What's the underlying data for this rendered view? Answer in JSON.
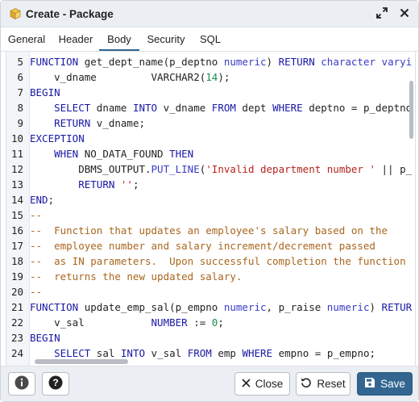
{
  "dialog": {
    "title": "Create - Package"
  },
  "tabs": [
    {
      "label": "General",
      "active": false
    },
    {
      "label": "Header",
      "active": false
    },
    {
      "label": "Body",
      "active": true
    },
    {
      "label": "Security",
      "active": false
    },
    {
      "label": "SQL",
      "active": false
    }
  ],
  "editor": {
    "lines": [
      {
        "n": "5",
        "tokens": [
          [
            "kw",
            "FUNCTION"
          ],
          [
            "p",
            " get_dept_name(p_deptno "
          ],
          [
            "ty",
            "numeric"
          ],
          [
            "p",
            ") "
          ],
          [
            "kw",
            "RETURN"
          ],
          [
            "p",
            " "
          ],
          [
            "ty",
            "character varyi"
          ]
        ]
      },
      {
        "n": "6",
        "tokens": [
          [
            "p",
            "    v_dname         VARCHAR2("
          ],
          [
            "num",
            "14"
          ],
          [
            "p",
            ");"
          ]
        ]
      },
      {
        "n": "7",
        "tokens": [
          [
            "kw",
            "BEGIN"
          ]
        ]
      },
      {
        "n": "8",
        "tokens": [
          [
            "p",
            "    "
          ],
          [
            "kw",
            "SELECT"
          ],
          [
            "p",
            " dname "
          ],
          [
            "kw",
            "INTO"
          ],
          [
            "p",
            " v_dname "
          ],
          [
            "kw",
            "FROM"
          ],
          [
            "p",
            " dept "
          ],
          [
            "kw",
            "WHERE"
          ],
          [
            "p",
            " deptno = p_deptno"
          ]
        ]
      },
      {
        "n": "9",
        "tokens": [
          [
            "p",
            "    "
          ],
          [
            "kw",
            "RETURN"
          ],
          [
            "p",
            " v_dname;"
          ]
        ]
      },
      {
        "n": "10",
        "tokens": [
          [
            "kw",
            "EXCEPTION"
          ]
        ]
      },
      {
        "n": "11",
        "tokens": [
          [
            "p",
            "    "
          ],
          [
            "kw",
            "WHEN"
          ],
          [
            "p",
            " NO_DATA_FOUND "
          ],
          [
            "kw",
            "THEN"
          ]
        ]
      },
      {
        "n": "12",
        "tokens": [
          [
            "p",
            "        DBMS_OUTPUT."
          ],
          [
            "ty",
            "PUT_LINE"
          ],
          [
            "p",
            "("
          ],
          [
            "str",
            "'Invalid department number '"
          ],
          [
            "p",
            " || p_"
          ]
        ]
      },
      {
        "n": "13",
        "tokens": [
          [
            "p",
            "        "
          ],
          [
            "kw",
            "RETURN"
          ],
          [
            "p",
            " "
          ],
          [
            "str",
            "''"
          ],
          [
            "p",
            ";"
          ]
        ]
      },
      {
        "n": "14",
        "tokens": [
          [
            "kw",
            "END"
          ],
          [
            "p",
            ";"
          ]
        ]
      },
      {
        "n": "15",
        "tokens": [
          [
            "cmt",
            "--"
          ]
        ]
      },
      {
        "n": "16",
        "tokens": [
          [
            "cmt",
            "--  Function that updates an employee's salary based on the"
          ]
        ]
      },
      {
        "n": "17",
        "tokens": [
          [
            "cmt",
            "--  employee number and salary increment/decrement passed"
          ]
        ]
      },
      {
        "n": "18",
        "tokens": [
          [
            "cmt",
            "--  as IN parameters.  Upon successful completion the function"
          ]
        ]
      },
      {
        "n": "19",
        "tokens": [
          [
            "cmt",
            "--  returns the new updated salary."
          ]
        ]
      },
      {
        "n": "20",
        "tokens": [
          [
            "cmt",
            "--"
          ]
        ]
      },
      {
        "n": "21",
        "tokens": [
          [
            "kw",
            "FUNCTION"
          ],
          [
            "p",
            " update_emp_sal(p_empno "
          ],
          [
            "ty",
            "numeric"
          ],
          [
            "p",
            ", p_raise "
          ],
          [
            "ty",
            "numeric"
          ],
          [
            "p",
            ") "
          ],
          [
            "kw",
            "RETUR"
          ]
        ]
      },
      {
        "n": "22",
        "tokens": [
          [
            "p",
            "    v_sal           "
          ],
          [
            "kw",
            "NUMBER"
          ],
          [
            "p",
            " := "
          ],
          [
            "num",
            "0"
          ],
          [
            "p",
            ";"
          ]
        ]
      },
      {
        "n": "23",
        "tokens": [
          [
            "kw",
            "BEGIN"
          ]
        ]
      },
      {
        "n": "24",
        "tokens": [
          [
            "p",
            "    "
          ],
          [
            "kw",
            "SELECT"
          ],
          [
            "p",
            " sal "
          ],
          [
            "kw",
            "INTO"
          ],
          [
            "p",
            " v_sal "
          ],
          [
            "kw",
            "FROM"
          ],
          [
            "p",
            " emp "
          ],
          [
            "kw",
            "WHERE"
          ],
          [
            "p",
            " empno = p_empno;"
          ]
        ]
      }
    ]
  },
  "footer": {
    "info_icon": "info-icon",
    "help_icon": "help-icon",
    "close_label": "Close",
    "reset_label": "Reset",
    "save_label": "Save"
  },
  "colors": {
    "accent": "#326690",
    "keyword": "#1818a6",
    "string": "#b4231b",
    "comment": "#a9661e",
    "number": "#1f8a4c"
  }
}
